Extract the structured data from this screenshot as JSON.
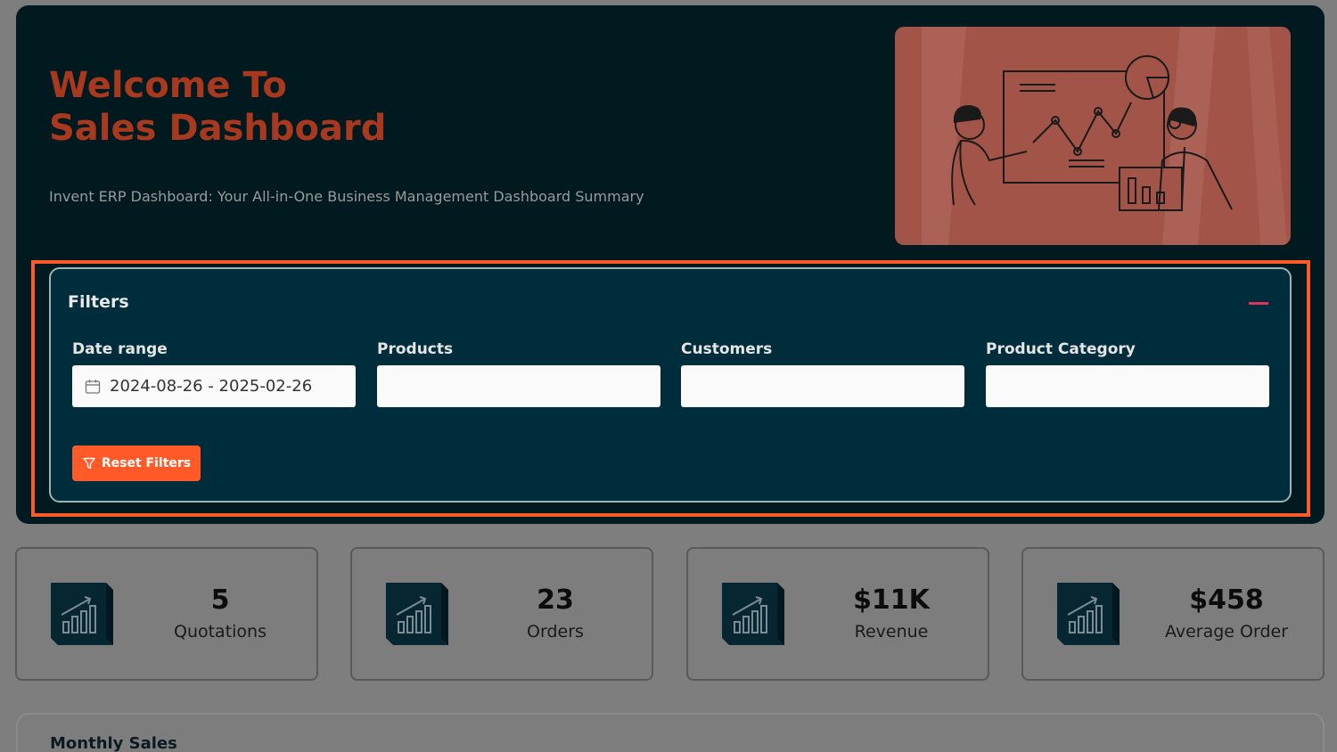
{
  "header": {
    "title_line1": "Welcome To",
    "title_line2": "Sales Dashboard",
    "subtitle": "Invent ERP Dashboard: Your All-in-One Business Management Dashboard Summary",
    "illustration_icon": "presentation-illustration"
  },
  "filters": {
    "title": "Filters",
    "collapse_icon": "minus-icon",
    "fields": [
      {
        "label": "Date range",
        "value": "2024-08-26 - 2025-02-26",
        "icon": "calendar-icon"
      },
      {
        "label": "Products",
        "value": ""
      },
      {
        "label": "Customers",
        "value": ""
      },
      {
        "label": "Product Category",
        "value": ""
      }
    ],
    "reset_label": "Reset Filters",
    "reset_icon": "filter-icon"
  },
  "stats": [
    {
      "value": "5",
      "label": "Quotations",
      "icon": "chart-icon"
    },
    {
      "value": "23",
      "label": "Orders",
      "icon": "chart-icon"
    },
    {
      "value": "$11K",
      "label": "Revenue",
      "icon": "chart-icon"
    },
    {
      "value": "$458",
      "label": "Average Order",
      "icon": "chart-icon"
    }
  ],
  "monthly": {
    "title": "Monthly Sales"
  },
  "colors": {
    "accent": "#ff5a28",
    "hero_bg": "#001a20",
    "filter_bg": "#002d3b",
    "title": "#a8391e"
  }
}
